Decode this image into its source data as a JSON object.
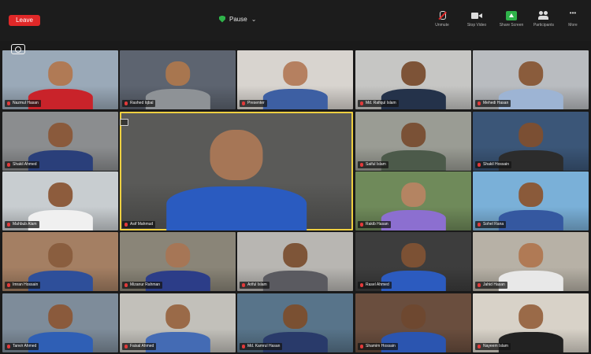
{
  "topbar": {
    "leave_label": "Leave",
    "view_label": "Pause",
    "tools": [
      {
        "label": "Unmute",
        "icon": "mic-muted-icon"
      },
      {
        "label": "Stop Video",
        "icon": "video-camera-icon"
      },
      {
        "label": "Share Screen",
        "icon": "share-screen-icon"
      },
      {
        "label": "Participants",
        "icon": "participants-icon"
      },
      {
        "label": "More",
        "icon": "more-icon"
      }
    ]
  },
  "colors": {
    "leave": "#e02828",
    "share": "#2fb34a",
    "active_speaker": "#f0d040",
    "muted_indicator": "#e23a3a"
  },
  "participants": [
    {
      "name": "Nazmul Hasan",
      "bg": "#9aa9b8",
      "skin": "#b07a55",
      "shirt": "#c9232a"
    },
    {
      "name": "Rashed Iqbal",
      "bg": "#5d6470",
      "skin": "#a8764f",
      "shirt": "#8e9296"
    },
    {
      "name": "Presenter",
      "bg": "#d8d4cf",
      "skin": "#b58060",
      "shirt": "#3d5fa3"
    },
    {
      "name": "Md. Rafiqul Islam",
      "bg": "#c6c6c4",
      "skin": "#7d5337",
      "shirt": "#24324a"
    },
    {
      "name": "Mehedi Hasan",
      "bg": "#b9bcc0",
      "skin": "#8a5c3c",
      "shirt": "#9db4d4"
    },
    {
      "name": "Shakil Ahmed",
      "bg": "#8b8d8f",
      "skin": "#8a5a3c",
      "shirt": "#2a3f7a"
    },
    {
      "name": "Asif Mahmud",
      "bg": "#5a5a58",
      "skin": "#a67656",
      "shirt": "#2a5bc0"
    },
    {
      "name": "Saiful Islam",
      "bg": "#9a9c94",
      "skin": "#7a5136",
      "shirt": "#4c5a4a"
    },
    {
      "name": "Shakil Hossain",
      "bg": "#3b5678",
      "skin": "#7b4f33",
      "shirt": "#2c2c2c"
    },
    {
      "name": "Mahbub Alam",
      "bg": "#c8cdd0",
      "skin": "#8d5c3d",
      "shirt": "#f0f0f0"
    },
    {
      "name": "Rakib Hasan",
      "bg": "#6f8a5a",
      "skin": "#b48462",
      "shirt": "#8c6fd0"
    },
    {
      "name": "Sohel Rana",
      "bg": "#7ab0d8",
      "skin": "#8a5a3a",
      "shirt": "#3558a0"
    },
    {
      "name": "Imran Hossain",
      "bg": "#a47f63",
      "skin": "#8a5e3f",
      "shirt": "#2e4f9a"
    },
    {
      "name": "Mizanur Rahman",
      "bg": "#8a8578",
      "skin": "#a67656",
      "shirt": "#2c3d88"
    },
    {
      "name": "Ariful Islam",
      "bg": "#b8b6b2",
      "skin": "#7e5538",
      "shirt": "#5a5a60"
    },
    {
      "name": "Rasel Ahmed",
      "bg": "#3d3d3d",
      "skin": "#7c5134",
      "shirt": "#2c5bbf"
    },
    {
      "name": "Jahid Hasan",
      "bg": "#b7b1a6",
      "skin": "#b07a55",
      "shirt": "#e8e8e8"
    },
    {
      "name": "Tanvir Ahmed",
      "bg": "#7e8c9a",
      "skin": "#8a5a3c",
      "shirt": "#2f5fb5"
    },
    {
      "name": "Faisal Ahmed",
      "bg": "#c2c0ba",
      "skin": "#9a6a48",
      "shirt": "#446bb4"
    },
    {
      "name": "Md. Kamrul Hasan",
      "bg": "#58748a",
      "skin": "#7a5032",
      "shirt": "#293a6a"
    },
    {
      "name": "Shamim Hossain",
      "bg": "#6a4e3e",
      "skin": "#6e4830",
      "shirt": "#2b55b0"
    },
    {
      "name": "Nayeem Islam",
      "bg": "#d8d2c8",
      "skin": "#9a6a48",
      "shirt": "#222222"
    }
  ]
}
